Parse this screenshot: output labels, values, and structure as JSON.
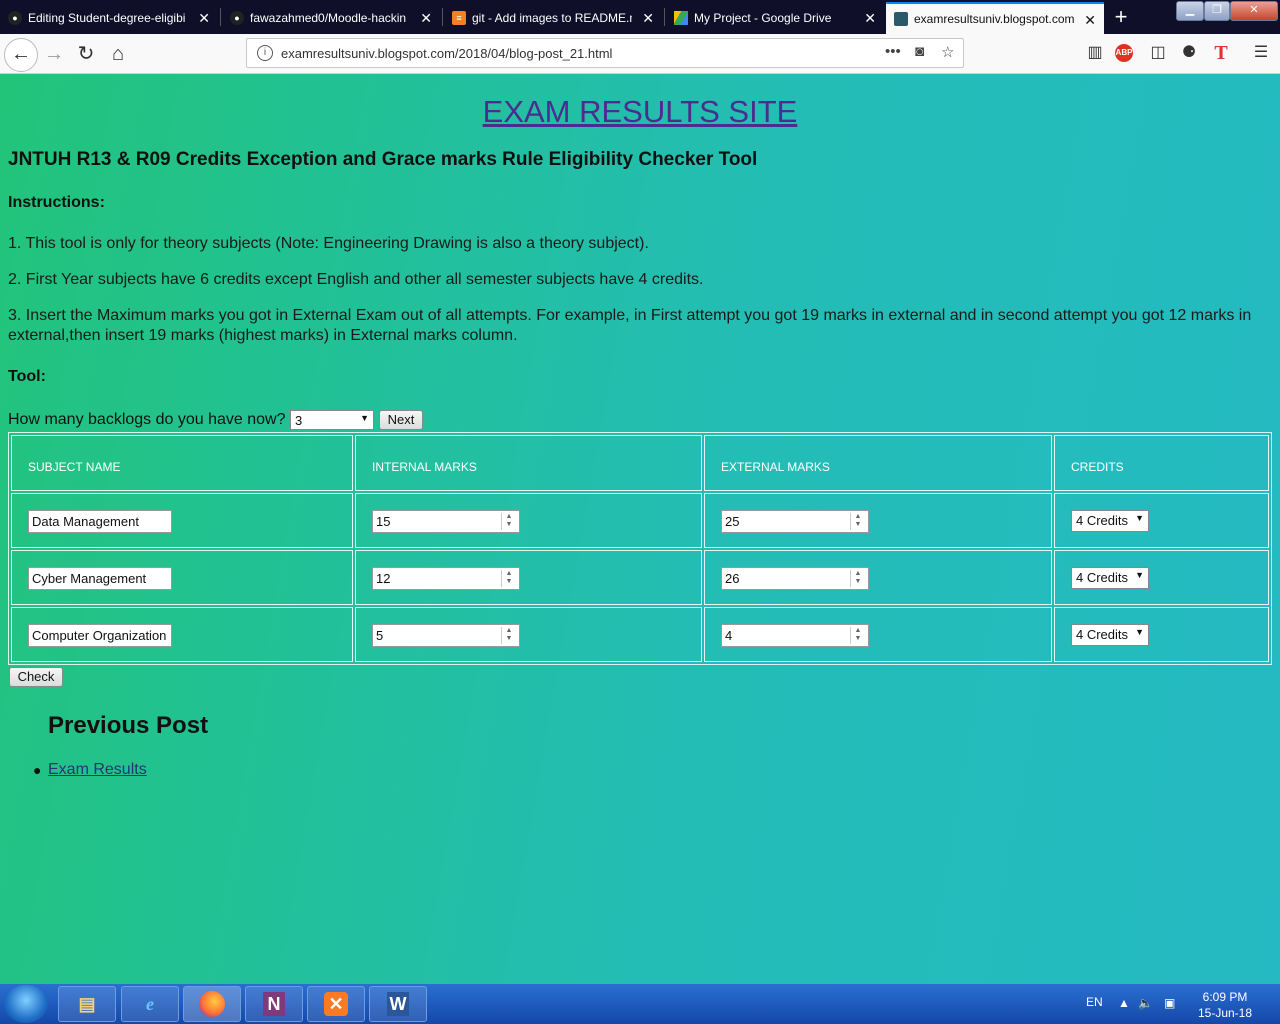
{
  "browser": {
    "tabs": [
      {
        "title": "Editing Student-degree-eligibi",
        "icon": "github-icon"
      },
      {
        "title": "fawazahmed0/Moodle-hackin",
        "icon": "github-icon"
      },
      {
        "title": "git - Add images to README.m",
        "icon": "stackoverflow-icon"
      },
      {
        "title": "My Project - Google Drive",
        "icon": "google-drive-icon"
      },
      {
        "title": "examresultsuniv.blogspot.com",
        "icon": "blogger-icon",
        "active": true
      }
    ],
    "url": "examresultsuniv.blogspot.com/2018/04/blog-post_21.html",
    "url_domain_color": "#333333"
  },
  "page": {
    "site_title": "EXAM RESULTS SITE",
    "heading": "JNTUH R13 & R09 Credits Exception and Grace marks Rule Eligibility Checker Tool",
    "instructions_heading": "Instructions:",
    "instructions": [
      "1. This tool is only for theory subjects (Note: Engineering Drawing is also a theory subject).",
      "2. First Year subjects have 6 credits except English and other all semester subjects have 4 credits.",
      "3. Insert the Maximum marks you got in External Exam out of all attempts. For example, in First attempt you got 19 marks in external and in second attempt you got 12 marks in external,then insert 19 marks (highest marks) in External marks column."
    ],
    "tool_heading": "Tool:",
    "backlogs_question": "How many backlogs do you have now?",
    "backlogs_value": "3",
    "next_label": "Next",
    "table": {
      "headers": [
        "SUBJECT NAME",
        "INTERNAL MARKS",
        "EXTERNAL MARKS",
        "CREDITS"
      ],
      "rows": [
        {
          "subject": "Data Management",
          "internal": "15",
          "external": "25",
          "credits": "4 Credits"
        },
        {
          "subject": "Cyber Management",
          "internal": "12",
          "external": "26",
          "credits": "4 Credits"
        },
        {
          "subject": "Computer Organization",
          "internal": "5",
          "external": "4",
          "credits": "4 Credits"
        }
      ]
    },
    "check_label": "Check",
    "previous_post_heading": "Previous Post",
    "previous_post_link": "Exam Results",
    "colors": {
      "title_link": "#4b2d90",
      "background_start": "#22c47a",
      "background_end": "#25bac3"
    }
  },
  "taskbar": {
    "apps": [
      "internet-explorer-icon",
      "firefox-icon",
      "onenote-icon",
      "xampp-icon",
      "word-icon",
      "file-explorer-icon"
    ],
    "lang": "EN",
    "time": "6:09 PM",
    "date": "15-Jun-18"
  }
}
